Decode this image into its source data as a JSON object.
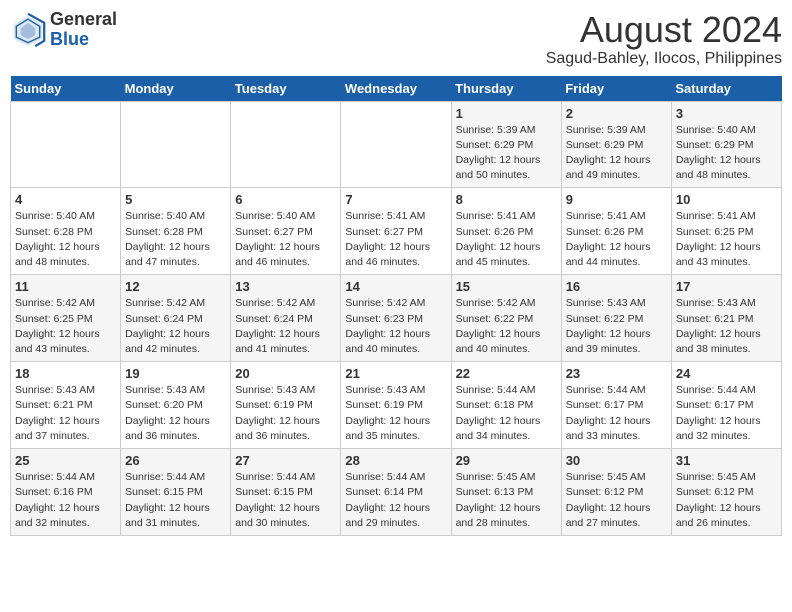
{
  "logo": {
    "general": "General",
    "blue": "Blue"
  },
  "title": "August 2024",
  "subtitle": "Sagud-Bahley, Ilocos, Philippines",
  "days_of_week": [
    "Sunday",
    "Monday",
    "Tuesday",
    "Wednesday",
    "Thursday",
    "Friday",
    "Saturday"
  ],
  "weeks": [
    [
      {
        "day": "",
        "info": ""
      },
      {
        "day": "",
        "info": ""
      },
      {
        "day": "",
        "info": ""
      },
      {
        "day": "",
        "info": ""
      },
      {
        "day": "1",
        "info": "Sunrise: 5:39 AM\nSunset: 6:29 PM\nDaylight: 12 hours\nand 50 minutes."
      },
      {
        "day": "2",
        "info": "Sunrise: 5:39 AM\nSunset: 6:29 PM\nDaylight: 12 hours\nand 49 minutes."
      },
      {
        "day": "3",
        "info": "Sunrise: 5:40 AM\nSunset: 6:29 PM\nDaylight: 12 hours\nand 48 minutes."
      }
    ],
    [
      {
        "day": "4",
        "info": "Sunrise: 5:40 AM\nSunset: 6:28 PM\nDaylight: 12 hours\nand 48 minutes."
      },
      {
        "day": "5",
        "info": "Sunrise: 5:40 AM\nSunset: 6:28 PM\nDaylight: 12 hours\nand 47 minutes."
      },
      {
        "day": "6",
        "info": "Sunrise: 5:40 AM\nSunset: 6:27 PM\nDaylight: 12 hours\nand 46 minutes."
      },
      {
        "day": "7",
        "info": "Sunrise: 5:41 AM\nSunset: 6:27 PM\nDaylight: 12 hours\nand 46 minutes."
      },
      {
        "day": "8",
        "info": "Sunrise: 5:41 AM\nSunset: 6:26 PM\nDaylight: 12 hours\nand 45 minutes."
      },
      {
        "day": "9",
        "info": "Sunrise: 5:41 AM\nSunset: 6:26 PM\nDaylight: 12 hours\nand 44 minutes."
      },
      {
        "day": "10",
        "info": "Sunrise: 5:41 AM\nSunset: 6:25 PM\nDaylight: 12 hours\nand 43 minutes."
      }
    ],
    [
      {
        "day": "11",
        "info": "Sunrise: 5:42 AM\nSunset: 6:25 PM\nDaylight: 12 hours\nand 43 minutes."
      },
      {
        "day": "12",
        "info": "Sunrise: 5:42 AM\nSunset: 6:24 PM\nDaylight: 12 hours\nand 42 minutes."
      },
      {
        "day": "13",
        "info": "Sunrise: 5:42 AM\nSunset: 6:24 PM\nDaylight: 12 hours\nand 41 minutes."
      },
      {
        "day": "14",
        "info": "Sunrise: 5:42 AM\nSunset: 6:23 PM\nDaylight: 12 hours\nand 40 minutes."
      },
      {
        "day": "15",
        "info": "Sunrise: 5:42 AM\nSunset: 6:22 PM\nDaylight: 12 hours\nand 40 minutes."
      },
      {
        "day": "16",
        "info": "Sunrise: 5:43 AM\nSunset: 6:22 PM\nDaylight: 12 hours\nand 39 minutes."
      },
      {
        "day": "17",
        "info": "Sunrise: 5:43 AM\nSunset: 6:21 PM\nDaylight: 12 hours\nand 38 minutes."
      }
    ],
    [
      {
        "day": "18",
        "info": "Sunrise: 5:43 AM\nSunset: 6:21 PM\nDaylight: 12 hours\nand 37 minutes."
      },
      {
        "day": "19",
        "info": "Sunrise: 5:43 AM\nSunset: 6:20 PM\nDaylight: 12 hours\nand 36 minutes."
      },
      {
        "day": "20",
        "info": "Sunrise: 5:43 AM\nSunset: 6:19 PM\nDaylight: 12 hours\nand 36 minutes."
      },
      {
        "day": "21",
        "info": "Sunrise: 5:43 AM\nSunset: 6:19 PM\nDaylight: 12 hours\nand 35 minutes."
      },
      {
        "day": "22",
        "info": "Sunrise: 5:44 AM\nSunset: 6:18 PM\nDaylight: 12 hours\nand 34 minutes."
      },
      {
        "day": "23",
        "info": "Sunrise: 5:44 AM\nSunset: 6:17 PM\nDaylight: 12 hours\nand 33 minutes."
      },
      {
        "day": "24",
        "info": "Sunrise: 5:44 AM\nSunset: 6:17 PM\nDaylight: 12 hours\nand 32 minutes."
      }
    ],
    [
      {
        "day": "25",
        "info": "Sunrise: 5:44 AM\nSunset: 6:16 PM\nDaylight: 12 hours\nand 32 minutes."
      },
      {
        "day": "26",
        "info": "Sunrise: 5:44 AM\nSunset: 6:15 PM\nDaylight: 12 hours\nand 31 minutes."
      },
      {
        "day": "27",
        "info": "Sunrise: 5:44 AM\nSunset: 6:15 PM\nDaylight: 12 hours\nand 30 minutes."
      },
      {
        "day": "28",
        "info": "Sunrise: 5:44 AM\nSunset: 6:14 PM\nDaylight: 12 hours\nand 29 minutes."
      },
      {
        "day": "29",
        "info": "Sunrise: 5:45 AM\nSunset: 6:13 PM\nDaylight: 12 hours\nand 28 minutes."
      },
      {
        "day": "30",
        "info": "Sunrise: 5:45 AM\nSunset: 6:12 PM\nDaylight: 12 hours\nand 27 minutes."
      },
      {
        "day": "31",
        "info": "Sunrise: 5:45 AM\nSunset: 6:12 PM\nDaylight: 12 hours\nand 26 minutes."
      }
    ]
  ]
}
